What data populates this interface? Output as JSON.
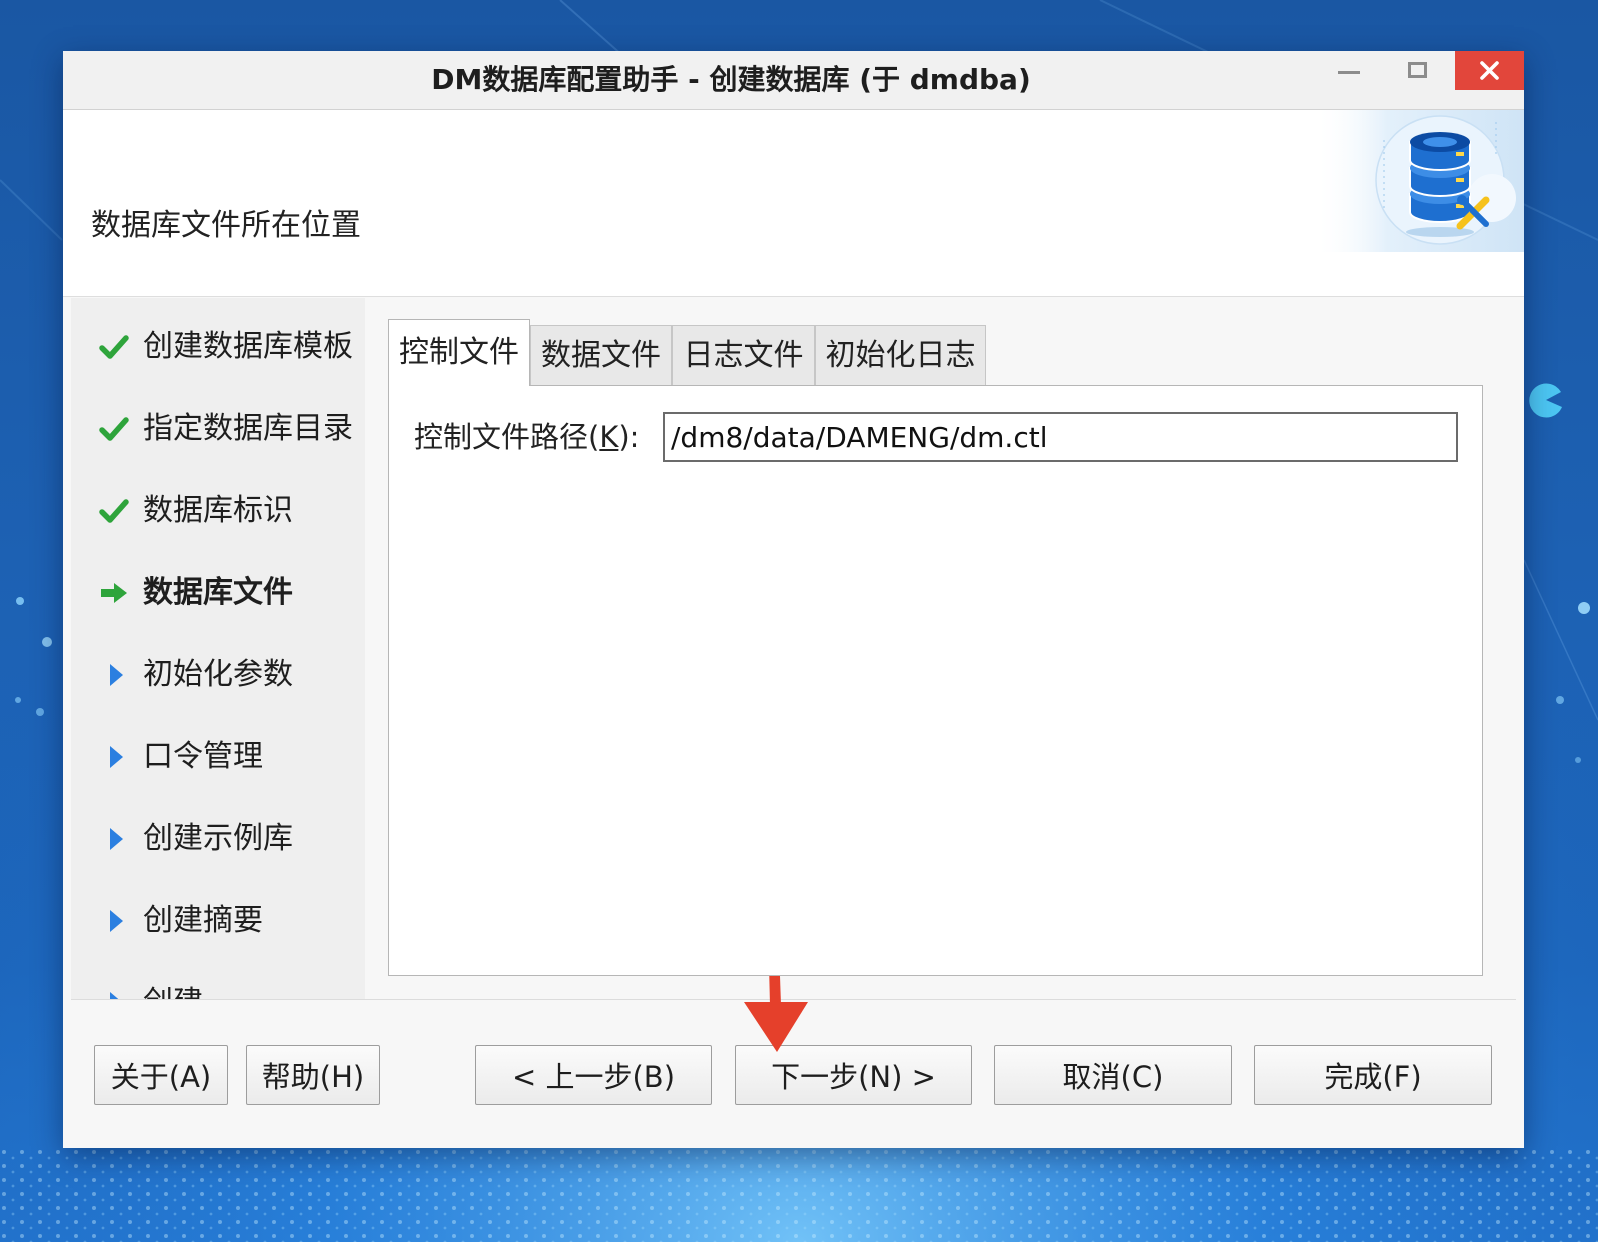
{
  "window": {
    "title": "DM数据库配置助手 - 创建数据库 (于 dmdba)",
    "minimize_icon": "minimize-icon",
    "maximize_icon": "maximize-icon",
    "close_icon": "close-icon"
  },
  "header": {
    "title": "数据库文件所在位置",
    "icon": "database-config-icon"
  },
  "sidebar": {
    "items": [
      {
        "label": "创建数据库模板",
        "icon": "check-icon"
      },
      {
        "label": "指定数据库目录",
        "icon": "check-icon"
      },
      {
        "label": "数据库标识",
        "icon": "check-icon"
      },
      {
        "label": "数据库文件",
        "icon": "arrow-right-icon",
        "current": true
      },
      {
        "label": "初始化参数",
        "icon": "triangle-right-icon"
      },
      {
        "label": "口令管理",
        "icon": "triangle-right-icon"
      },
      {
        "label": "创建示例库",
        "icon": "triangle-right-icon"
      },
      {
        "label": "创建摘要",
        "icon": "triangle-right-icon"
      },
      {
        "label": "创建",
        "icon": "triangle-right-icon"
      }
    ]
  },
  "tabs": [
    {
      "label": "控制文件",
      "active": true
    },
    {
      "label": "数据文件",
      "active": false
    },
    {
      "label": "日志文件",
      "active": false
    },
    {
      "label": "初始化日志",
      "active": false
    }
  ],
  "control_file": {
    "path_label": {
      "prefix": "控制文件路径(",
      "mnemonic": "K",
      "suffix": "):"
    },
    "path_value": "/dm8/data/DAMENG/dm.ctl"
  },
  "buttons": {
    "about": "关于(A)",
    "help": "帮助(H)",
    "back": "< 上一步(B)",
    "next": "下一步(N) >",
    "cancel": "取消(C)",
    "finish": "完成(F)"
  },
  "annotation": {
    "icon": "red-arrow-down-icon"
  },
  "colors": {
    "check_green": "#2ea43b",
    "triangle_blue": "#2b7fe0",
    "close_red": "#e2463b",
    "annotation_red": "#e5402b"
  }
}
